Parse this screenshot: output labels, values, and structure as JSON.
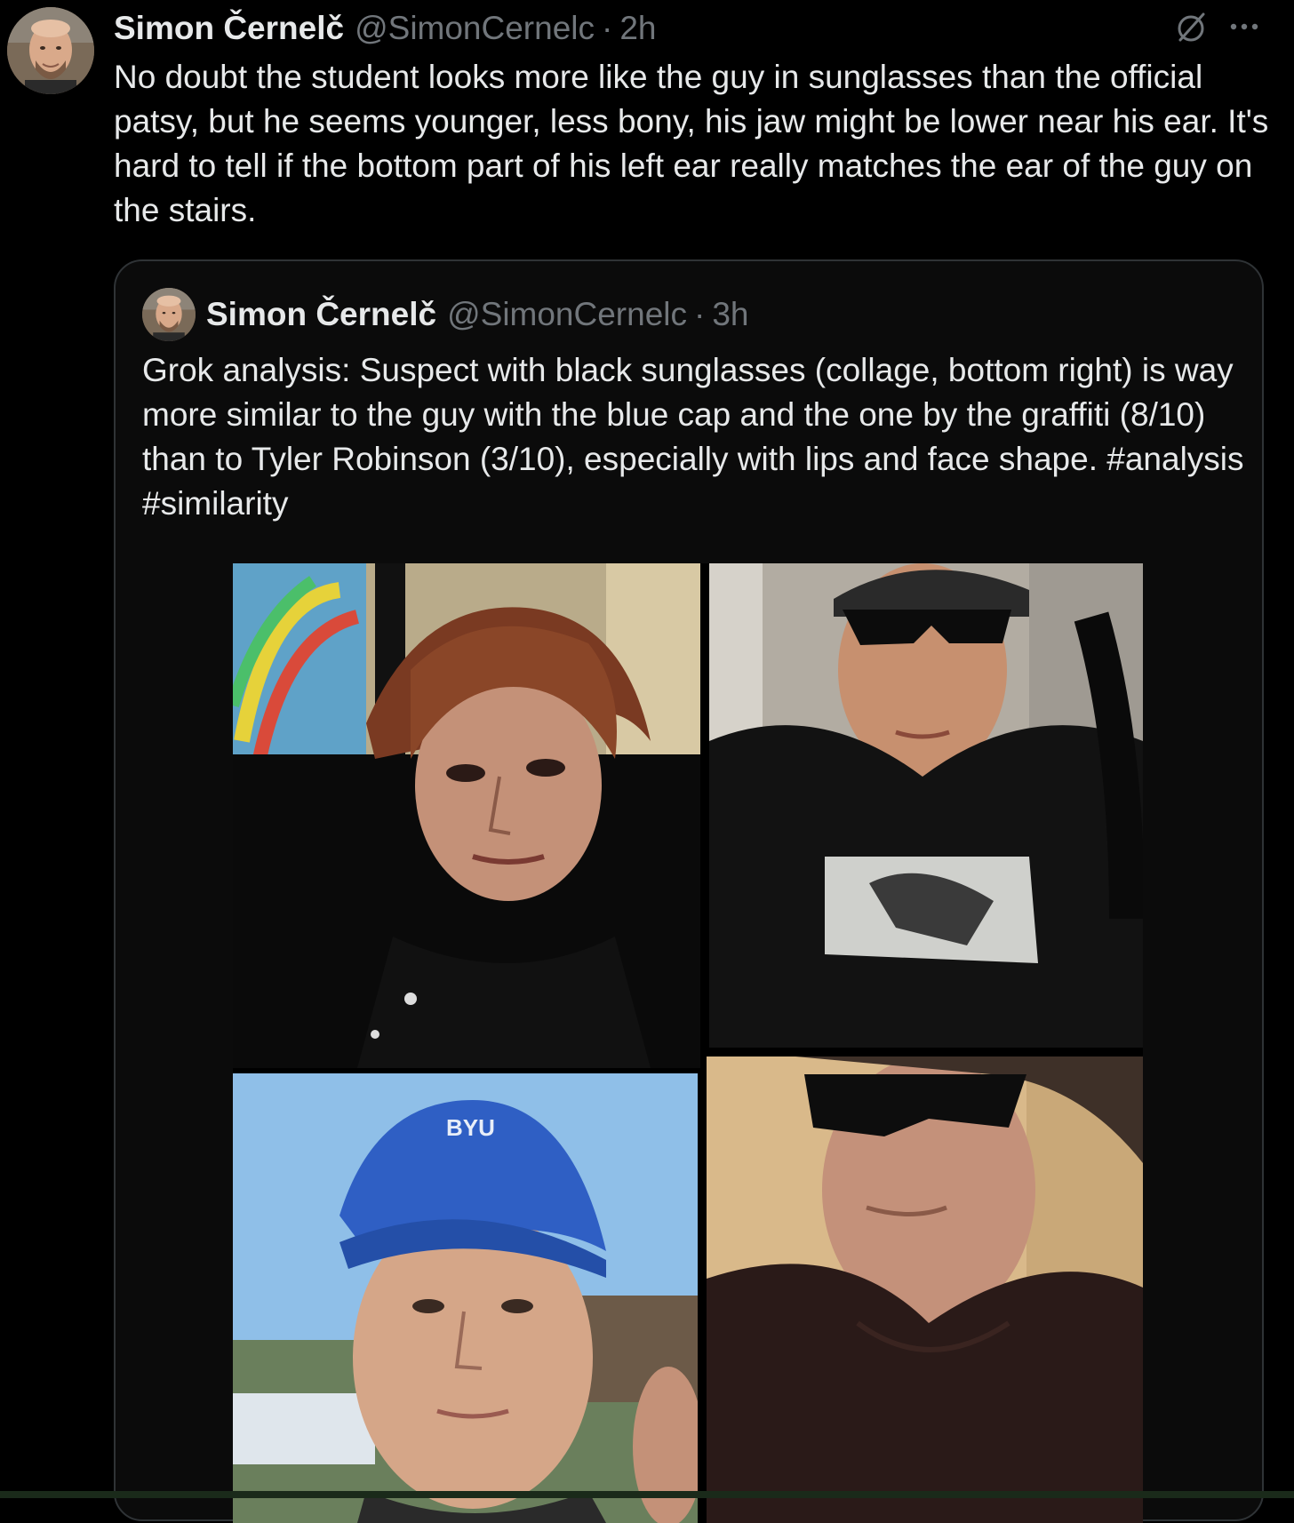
{
  "post": {
    "author_name": "Simon Černelč",
    "author_handle": "@SimonCernelc",
    "separator": "·",
    "time": "2h",
    "text": "No doubt the student looks more like the guy in sunglasses than the official patsy, but he seems younger, less bony, his jaw might be lower near his ear. It's hard to tell if the bottom part of his left ear really matches the ear of the guy on the stairs.",
    "icons": {
      "grok": "slashed-circle-icon",
      "more": "more-dots-icon"
    }
  },
  "quote": {
    "author_name": "Simon Černelč",
    "author_handle": "@SimonCernelc",
    "separator": "·",
    "time": "3h",
    "text": "Grok analysis: Suspect with black sunglasses (collage, bottom right) is way more similar to the guy with the blue cap and the one by the graffiti (8/10) than to Tyler Robinson (3/10), especially with lips and face shape. #analysis #similarity",
    "media": {
      "photos": [
        {
          "name": "photo-top-left",
          "description": "man-with-reddish-hair-by-graffiti"
        },
        {
          "name": "photo-top-right",
          "description": "man-with-sunglasses-and-cap-graphic-tee"
        },
        {
          "name": "photo-bottom-left",
          "description": "man-with-blue-cap"
        },
        {
          "name": "photo-bottom-right",
          "description": "man-with-black-sunglasses"
        }
      ],
      "cap_text": "BYU"
    }
  },
  "colors": {
    "background": "#000000",
    "text_primary": "#e7e9ea",
    "text_secondary": "#71767b",
    "border": "#2f3336",
    "cap_blue": "#2f5fc4",
    "sky_blue": "#8fbfe8"
  }
}
